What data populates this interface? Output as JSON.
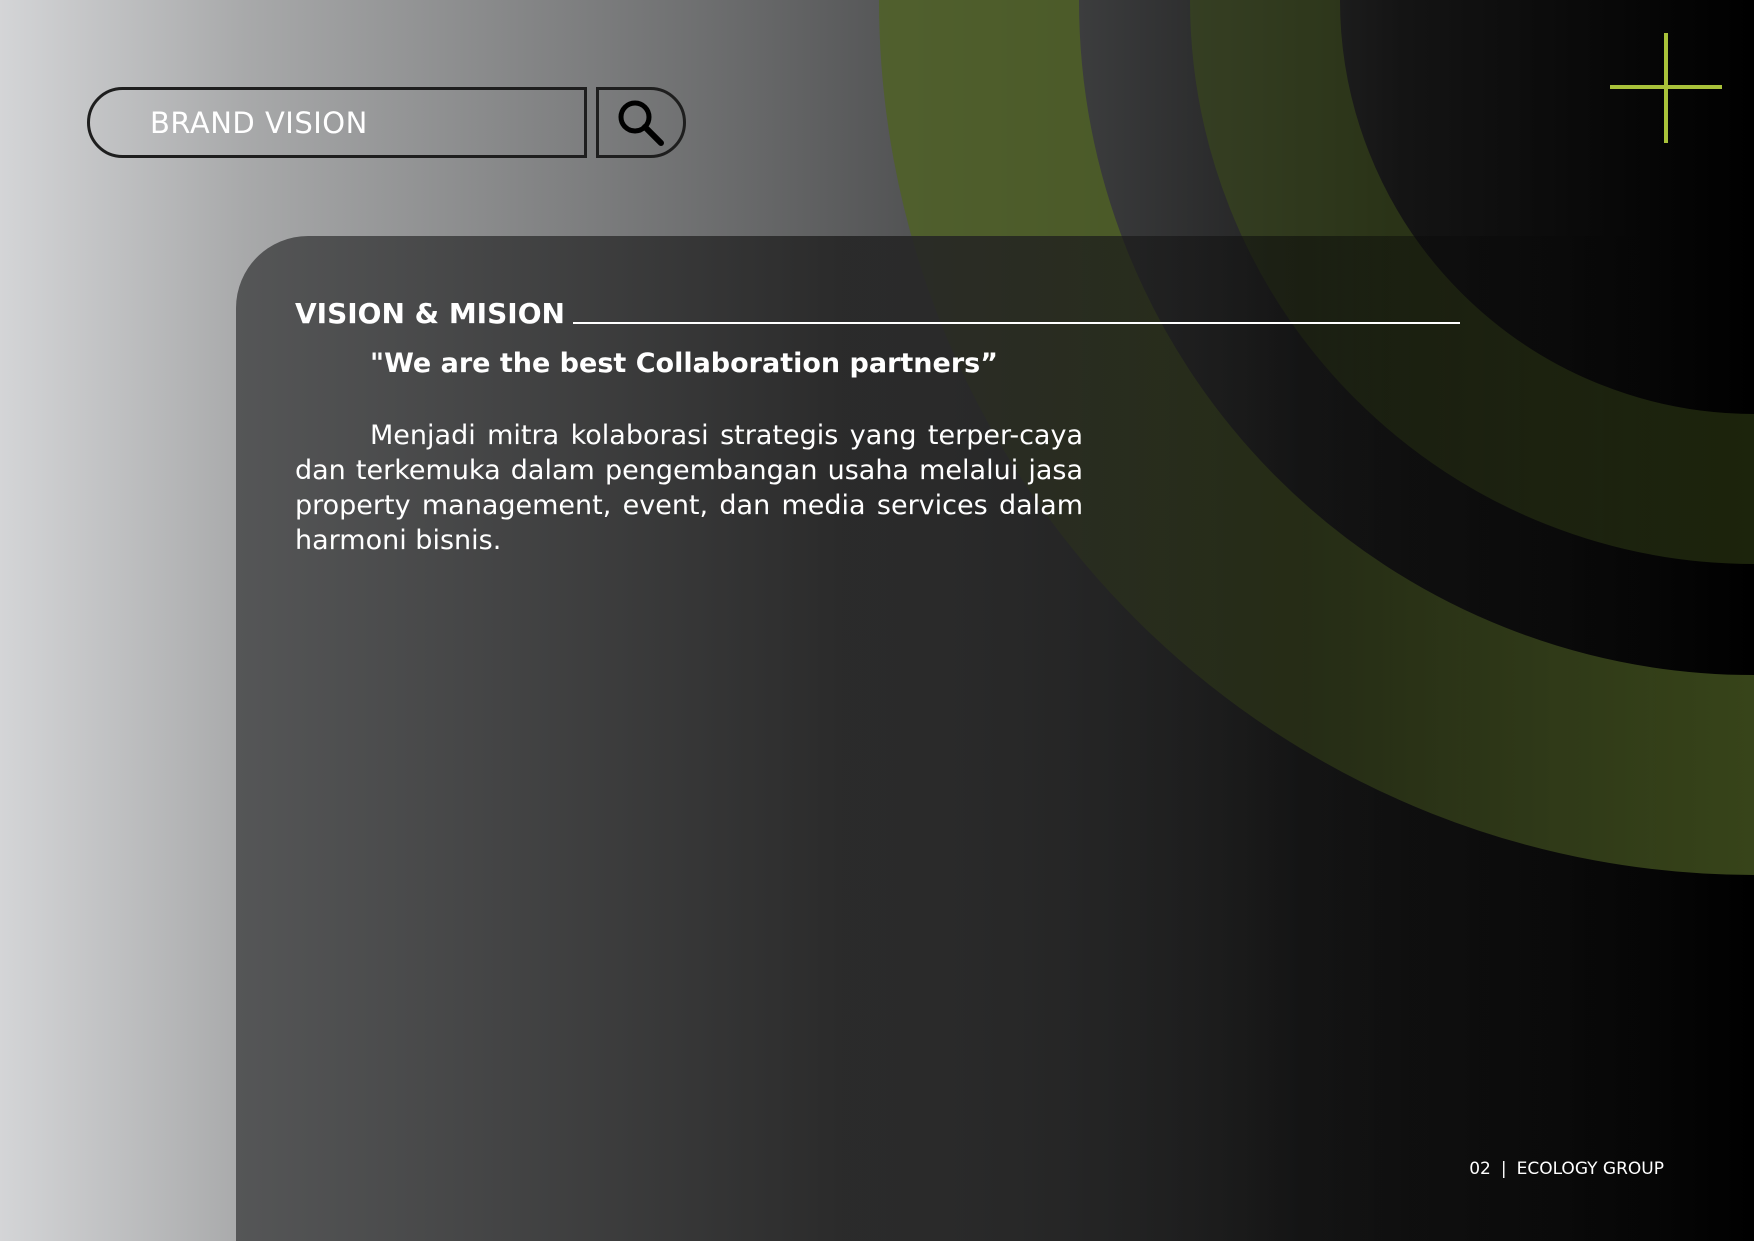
{
  "search": {
    "label": "BRAND VISION",
    "icon": "search-icon"
  },
  "decoration": {
    "accent_color": "#a9c23a",
    "plus_icon": "plus-icon"
  },
  "section": {
    "heading": "VISION & MISION",
    "quote": "\"We are the best Collaboration partners”",
    "body": "Menjadi mitra kolaborasi strategis yang terper-caya dan terkemuka dalam pengembangan usaha melalui jasa property management, event, dan media services dalam harmoni bisnis."
  },
  "footer": {
    "page_number": "02",
    "separator": "|",
    "company": "ECOLOGY GROUP"
  }
}
